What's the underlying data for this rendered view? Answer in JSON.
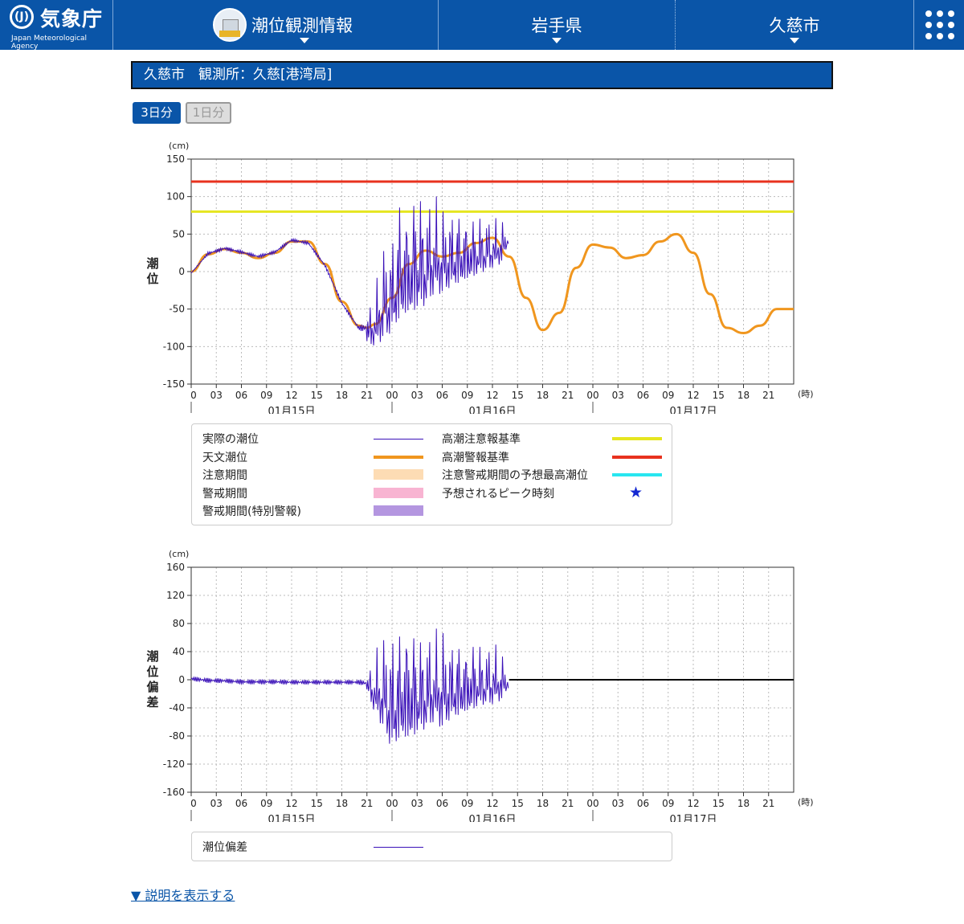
{
  "header": {
    "logo_mark": "(J)",
    "logo_jp": "気象庁",
    "logo_en": "Japan Meteorological Agency",
    "nav": [
      "潮位観測情報",
      "岩手県",
      "久慈市"
    ],
    "menu_icon": "grid-menu-icon"
  },
  "title": "久慈市　観測所：久慈[港湾局]",
  "tabs": [
    "3日分",
    "1日分"
  ],
  "colors": {
    "brand": "#0a55a8",
    "observed": "#3a10b8",
    "astronomical": "#f0961e",
    "advisory": "#e6e620",
    "warning": "#e8321e",
    "forecast_max": "#28e6f0",
    "caution_period": "#fddcb4",
    "warning_period": "#f8b4d2",
    "special_warning_period": "#b496e0",
    "star": "#1428d2"
  },
  "chart_data": [
    {
      "type": "line",
      "unit": "(cm)",
      "ylabel": "潮位",
      "ylim": [
        -150,
        150
      ],
      "yticks": [
        150,
        100,
        50,
        0,
        -50,
        -100,
        -150
      ],
      "x_tick_labels": [
        "0",
        "03",
        "06",
        "09",
        "12",
        "15",
        "18",
        "21",
        "00",
        "03",
        "06",
        "09",
        "12",
        "15",
        "18",
        "21",
        "00",
        "03",
        "06",
        "09",
        "12",
        "15",
        "18",
        "21"
      ],
      "x_unit": "(時)",
      "dates": [
        "01月15日",
        "01月16日",
        "01月17日"
      ],
      "xlim_hours": [
        0,
        72
      ],
      "reference_lines": [
        {
          "name": "高潮警報基準",
          "value": 120
        },
        {
          "name": "高潮注意報基準",
          "value": 80
        }
      ],
      "series": [
        {
          "name": "天文潮位",
          "hours": [
            0,
            2,
            4,
            6,
            8,
            10,
            12,
            14,
            16,
            18,
            20,
            21,
            22,
            24,
            26,
            28,
            30,
            32,
            34,
            36,
            38,
            40,
            42,
            44,
            46,
            48,
            50,
            52,
            54,
            56,
            58,
            60,
            62,
            64,
            66,
            68,
            70,
            72
          ],
          "values": [
            0,
            23,
            30,
            25,
            18,
            25,
            40,
            40,
            10,
            -40,
            -72,
            -75,
            -70,
            -35,
            10,
            28,
            20,
            25,
            38,
            45,
            20,
            -35,
            -78,
            -55,
            5,
            36,
            32,
            18,
            22,
            40,
            50,
            25,
            -30,
            -75,
            -82,
            -72,
            -50,
            -50
          ]
        },
        {
          "name": "実際の潮位",
          "hours": [
            0,
            2,
            4,
            6,
            8,
            10,
            12,
            14,
            16,
            18,
            20,
            21,
            22,
            23,
            24,
            25,
            26,
            27,
            28,
            29,
            30,
            31,
            32,
            33,
            34,
            35,
            36,
            37,
            38
          ],
          "values": [
            -2,
            24,
            32,
            26,
            20,
            26,
            42,
            38,
            8,
            -42,
            -75,
            -68,
            -85,
            -40,
            -90,
            60,
            -60,
            110,
            -40,
            90,
            -50,
            85,
            -20,
            70,
            -10,
            60,
            0,
            65,
            45
          ],
          "envelope_low": [
            -2,
            20,
            26,
            22,
            16,
            22,
            38,
            34,
            4,
            -46,
            -79,
            -95,
            -100,
            -90,
            -80,
            -60,
            -55,
            -50,
            -45,
            -30,
            -30,
            -20,
            -15,
            -10,
            -5,
            0,
            5,
            10,
            40
          ],
          "envelope_high": [
            -2,
            28,
            36,
            30,
            24,
            30,
            46,
            42,
            12,
            -38,
            -71,
            -55,
            -20,
            40,
            50,
            110,
            90,
            125,
            100,
            105,
            90,
            90,
            85,
            80,
            75,
            80,
            70,
            75,
            50
          ]
        }
      ],
      "legend": [
        {
          "label": "実際の潮位",
          "kind": "line",
          "color_key": "observed"
        },
        {
          "label": "天文潮位",
          "kind": "line",
          "color_key": "astronomical"
        },
        {
          "label": "注意期間",
          "kind": "band",
          "color_key": "caution_period"
        },
        {
          "label": "警戒期間",
          "kind": "band",
          "color_key": "warning_period"
        },
        {
          "label": "警戒期間(特別警報)",
          "kind": "band",
          "color_key": "special_warning_period"
        },
        {
          "label": "高潮注意報基準",
          "kind": "line",
          "color_key": "advisory"
        },
        {
          "label": "高潮警報基準",
          "kind": "line",
          "color_key": "warning"
        },
        {
          "label": "注意警戒期間の予想最高潮位",
          "kind": "line",
          "color_key": "forecast_max"
        },
        {
          "label": "予想されるピーク時刻",
          "kind": "star",
          "color_key": "star"
        }
      ]
    },
    {
      "type": "line",
      "unit": "(cm)",
      "ylabel": "潮位偏差",
      "ylim": [
        -160,
        160
      ],
      "yticks": [
        160,
        120,
        80,
        40,
        0,
        -40,
        -80,
        -120,
        -160
      ],
      "x_tick_labels": [
        "0",
        "03",
        "06",
        "09",
        "12",
        "15",
        "18",
        "21",
        "00",
        "03",
        "06",
        "09",
        "12",
        "15",
        "18",
        "21",
        "00",
        "03",
        "06",
        "09",
        "12",
        "15",
        "18",
        "21"
      ],
      "x_unit": "(時)",
      "dates": [
        "01月15日",
        "01月16日",
        "01月17日"
      ],
      "xlim_hours": [
        0,
        72
      ],
      "series": [
        {
          "name": "潮位偏差",
          "hours": [
            0,
            2,
            4,
            6,
            8,
            10,
            12,
            14,
            16,
            18,
            20,
            21,
            22,
            23,
            24,
            25,
            26,
            27,
            28,
            29,
            30,
            31,
            32,
            33,
            34,
            35,
            36,
            37,
            38
          ],
          "envelope_low": [
            -5,
            -8,
            -8,
            -10,
            -10,
            -10,
            -10,
            -10,
            -10,
            -10,
            -10,
            -15,
            -50,
            -70,
            -100,
            -80,
            -85,
            -75,
            -70,
            -60,
            -70,
            -55,
            -50,
            -45,
            -40,
            -35,
            -35,
            -30,
            -10
          ],
          "envelope_high": [
            8,
            6,
            5,
            4,
            4,
            4,
            3,
            3,
            3,
            3,
            3,
            5,
            40,
            70,
            75,
            80,
            100,
            70,
            75,
            70,
            80,
            65,
            60,
            55,
            60,
            50,
            55,
            45,
            10
          ]
        }
      ],
      "legend": [
        {
          "label": "潮位偏差",
          "kind": "line",
          "color_key": "observed"
        }
      ]
    }
  ],
  "more_link": "▼ 説明を表示する"
}
